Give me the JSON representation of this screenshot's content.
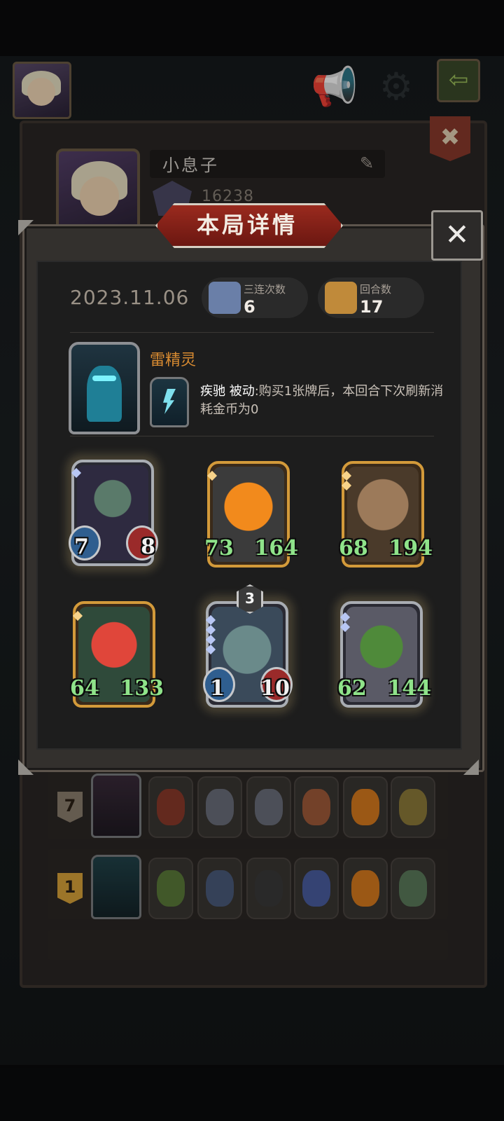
{
  "profile": {
    "name": "小息子",
    "score": "16238"
  },
  "modal": {
    "title": "本局详情",
    "date": "2023.11.06",
    "stats": [
      {
        "label": "三连次数",
        "value": "6",
        "icon": "triple-icon"
      },
      {
        "label": "回合数",
        "value": "17",
        "icon": "rounds-icon"
      }
    ],
    "hero": {
      "name": "雷精灵",
      "skill_keyword": "疾驰",
      "skill_type": "被动",
      "skill_text": ":购买1张牌后，本回合下次刷新消耗金币为0"
    },
    "cards": [
      {
        "atk": "7",
        "hp": "8",
        "frame": "silver",
        "golden_numbers": false,
        "level": null,
        "art": "demon-elf"
      },
      {
        "atk": "73",
        "hp": "164",
        "frame": "gold",
        "golden_numbers": true,
        "level": null,
        "art": "pumpkin"
      },
      {
        "atk": "68",
        "hp": "194",
        "frame": "gold",
        "golden_numbers": true,
        "level": null,
        "art": "treant"
      },
      {
        "atk": "64",
        "hp": "133",
        "frame": "gold",
        "golden_numbers": true,
        "level": null,
        "art": "red-imp"
      },
      {
        "atk": "1",
        "hp": "10",
        "frame": "silver",
        "golden_numbers": false,
        "level": "3",
        "art": "shark"
      },
      {
        "atk": "62",
        "hp": "144",
        "frame": "silver",
        "golden_numbers": true,
        "level": null,
        "art": "goblin-knight"
      }
    ]
  },
  "history": [
    {
      "rank": "7",
      "rank_color": "#8b7e6e"
    },
    {
      "rank": "1",
      "rank_color": "#d9a23a"
    }
  ],
  "colors": {
    "accent_orange": "#d98b31",
    "stat_green": "#8fe38a",
    "banner_red": "#8a231a"
  }
}
